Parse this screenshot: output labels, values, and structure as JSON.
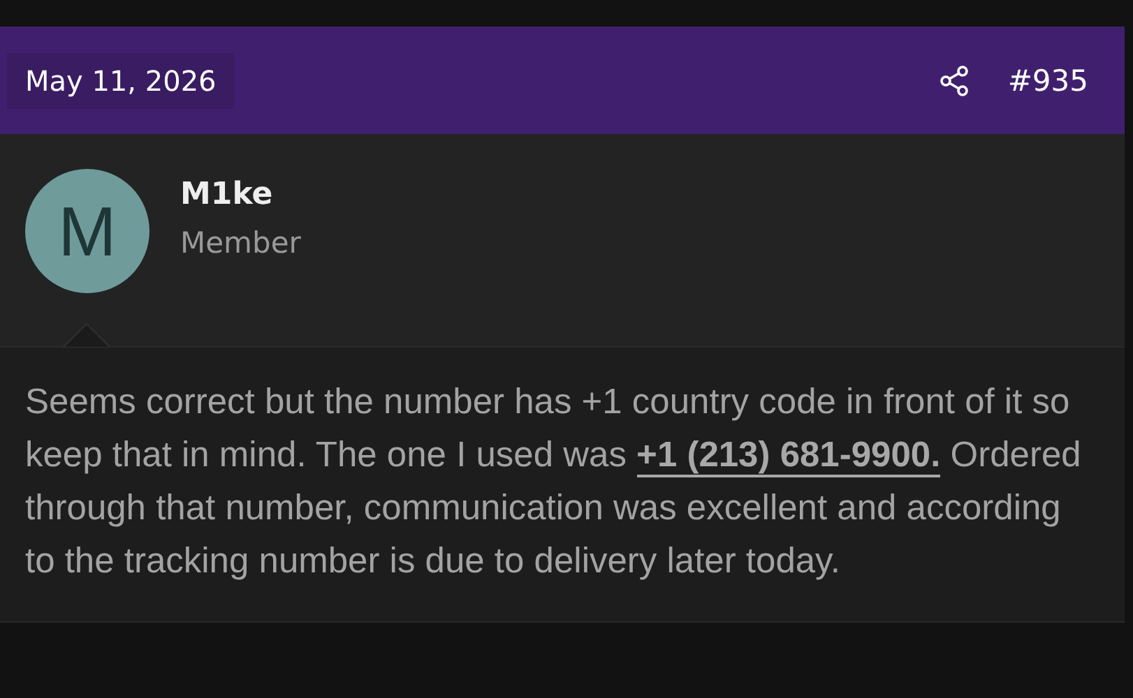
{
  "post": {
    "date": "May 11, 2026",
    "number": "#935"
  },
  "author": {
    "initial": "M",
    "name": "M1ke",
    "role": "Member"
  },
  "message": {
    "before": "Seems correct but the number has +1 country code in front of it so keep that in mind. The one I used was ",
    "link": "+1 (213) 681-9900.",
    "after": " Ordered through that number, communication was excellent and according to the tracking number is due to delivery later today."
  }
}
